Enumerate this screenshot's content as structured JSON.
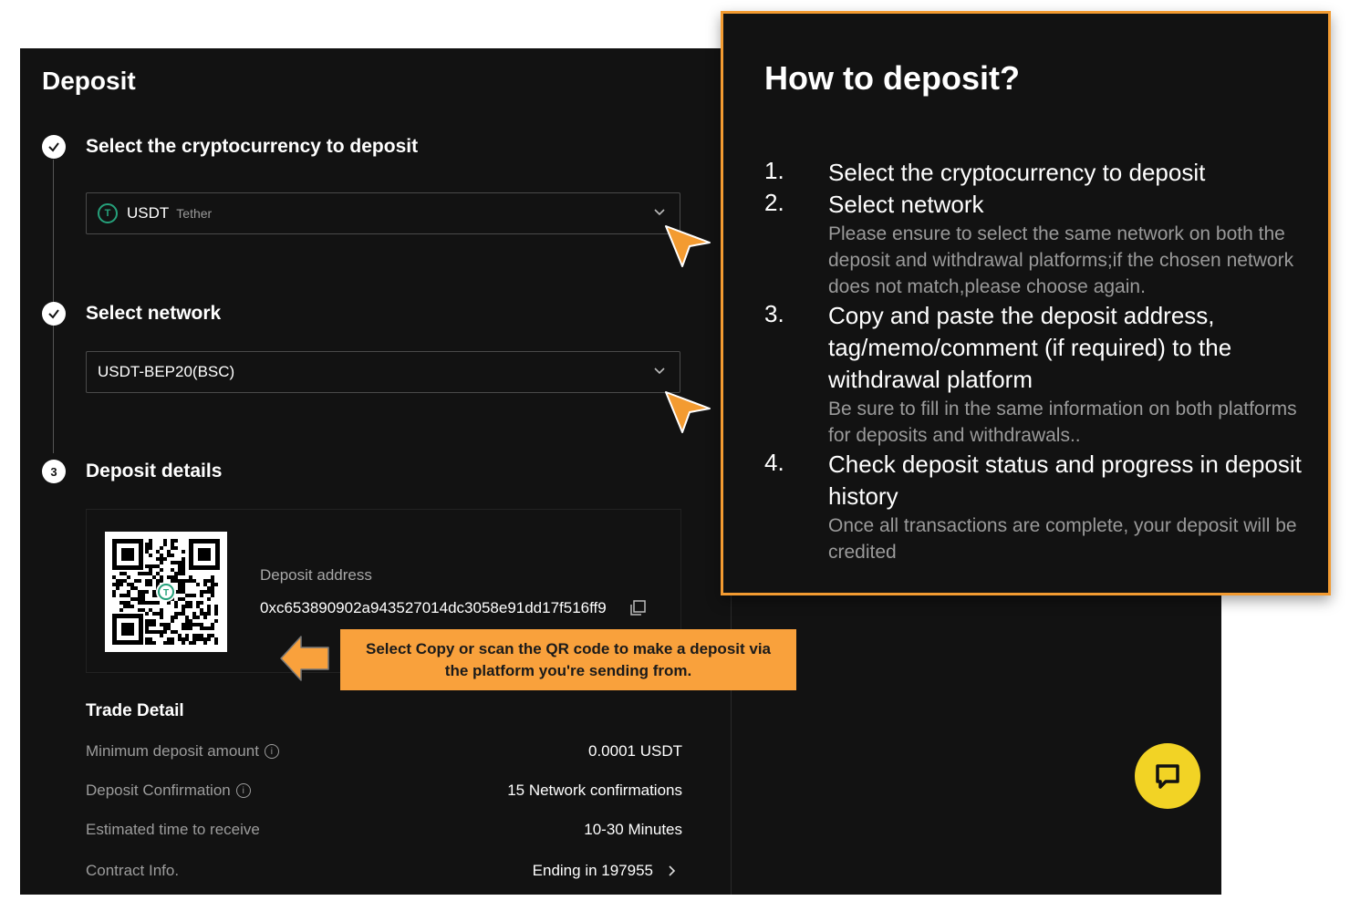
{
  "page_title": "Deposit",
  "steps": [
    {
      "label": "Select the cryptocurrency to deposit",
      "icon": "check-icon"
    },
    {
      "label": "Select network",
      "icon": "check-icon"
    },
    {
      "label": "Deposit details",
      "number": "3"
    }
  ],
  "crypto_select": {
    "symbol": "USDT",
    "name": "Tether",
    "coin_icon_letter": "T"
  },
  "network_select": {
    "value": "USDT-BEP20(BSC)"
  },
  "deposit": {
    "address_label": "Deposit address",
    "address": "0xc653890902a943527014dc3058e91dd17f516ff9"
  },
  "callout": {
    "line1": "Select Copy or scan the QR code to make a deposit via",
    "line2": "the platform you're sending from."
  },
  "trade_detail": {
    "title": "Trade Detail",
    "rows": [
      {
        "label": "Minimum deposit amount",
        "value": "0.0001 USDT",
        "info": true
      },
      {
        "label": "Deposit Confirmation",
        "value": "15 Network confirmations",
        "info": true
      },
      {
        "label": "Estimated time to receive",
        "value": "10-30 Minutes",
        "info": false
      },
      {
        "label": "Contract Info.",
        "value": "Ending in 197955",
        "info": false
      }
    ]
  },
  "how_to": {
    "title": "How to deposit?",
    "steps": [
      {
        "num": "1.",
        "text": "Select the cryptocurrency to deposit",
        "sub": ""
      },
      {
        "num": "2.",
        "text": "Select network",
        "sub": "Please ensure to select the same network on both the deposit and withdrawal platforms;if the chosen network does not match,please choose again."
      },
      {
        "num": "3.",
        "text": "Copy and paste the deposit address, tag/memo/comment (if required) to the withdrawal platform",
        "sub": "Be sure to fill in the same information on both platforms for deposits and withdrawals.."
      },
      {
        "num": "4.",
        "text": "Check deposit status and progress in deposit history",
        "sub": "Once all transactions are complete, your deposit will be credited"
      }
    ]
  },
  "colors": {
    "accent": "#f39b31",
    "callout": "#f9a13c",
    "chat": "#f2d325",
    "background": "#121212",
    "tether": "#26a17b"
  },
  "icons": {
    "chat": "chat-bubble-icon",
    "copy": "copy-icon",
    "chevron": "chevron-down-icon"
  }
}
